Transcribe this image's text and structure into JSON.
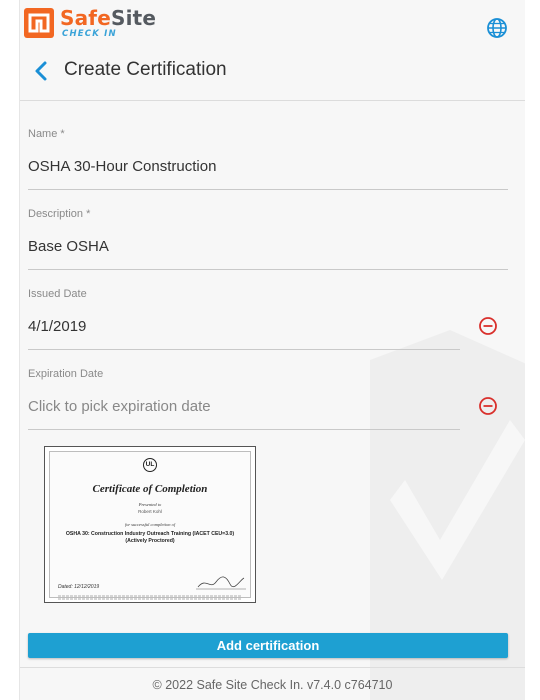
{
  "brand": {
    "name_part1": "Safe",
    "name_part2": "Site",
    "tagline": "CHECK IN",
    "colors": {
      "orange": "#f26722",
      "gray": "#555a60",
      "blue": "#3aa3d8"
    }
  },
  "header": {
    "title": "Create Certification",
    "globe_icon": "globe-icon",
    "back_icon": "chevron-left-icon"
  },
  "form": {
    "name": {
      "label": "Name *",
      "value": "OSHA 30-Hour Construction"
    },
    "description": {
      "label": "Description *",
      "value": "Base OSHA"
    },
    "issued_date": {
      "label": "Issued Date",
      "value": "4/1/2019"
    },
    "expiration_date": {
      "label": "Expiration Date",
      "placeholder": "Click to pick expiration date"
    }
  },
  "certificate_image": {
    "logo": "UL",
    "title": "Certificate of Completion",
    "presented_to": "Presented to",
    "recipient": "Robert Kohl",
    "for_completion": "for successful completion of",
    "course_line1": "OSHA 30: Construction Industry Outreach Training (IACET CEU=3.0)",
    "course_line2": "(Actively Proctored)",
    "dated": "Dated: 12/12/2019"
  },
  "actions": {
    "add_label": "Add certification"
  },
  "footer": {
    "text": "© 2022 Safe Site Check In. v7.4.0 c764710"
  },
  "colors": {
    "accent": "#1ea0d2",
    "remove_red": "#d9302c"
  }
}
